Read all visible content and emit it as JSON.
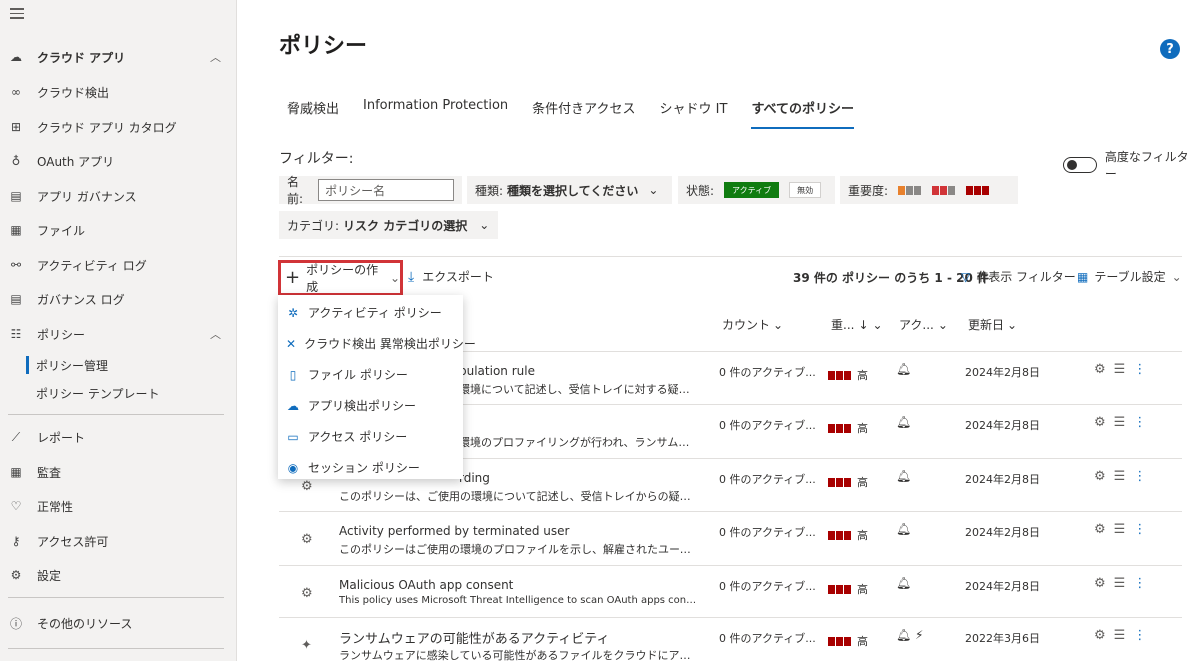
{
  "sidebar": {
    "cloud_apps": "クラウド アプリ",
    "items": [
      {
        "label": "クラウド検出",
        "icon": "binoculars-icon"
      },
      {
        "label": "クラウド アプリ カタログ",
        "icon": "catalog-icon"
      },
      {
        "label": "OAuth アプリ",
        "icon": "oauth-icon"
      },
      {
        "label": "アプリ ガバナンス",
        "icon": "clipboard-icon"
      },
      {
        "label": "ファイル",
        "icon": "file-icon"
      },
      {
        "label": "アクティビティ ログ",
        "icon": "glasses-icon"
      },
      {
        "label": "ガバナンス ログ",
        "icon": "clipboard-icon"
      }
    ],
    "policies": "ポリシー",
    "sub_items": [
      "ポリシー管理",
      "ポリシー テンプレート"
    ],
    "lower_items": [
      {
        "label": "レポート",
        "icon": "chart-icon"
      },
      {
        "label": "監査",
        "icon": "audit-icon"
      },
      {
        "label": "正常性",
        "icon": "heart-icon"
      },
      {
        "label": "アクセス許可",
        "icon": "key-icon"
      },
      {
        "label": "設定",
        "icon": "gear-icon"
      }
    ],
    "more_resources": "その他のリソース"
  },
  "page": {
    "title": "ポリシー",
    "help": "?"
  },
  "tabs": [
    "脅威検出",
    "Information Protection",
    "条件付きアクセス",
    "シャドウ IT",
    "すべてのポリシー"
  ],
  "filters": {
    "title": "フィルター:",
    "advanced": "高度なフィルター",
    "name_label": "名前:",
    "name_placeholder": "ポリシー名",
    "type_label": "種類:",
    "type_value": "種類を選択してください",
    "state_label": "状態:",
    "state_active": "アクティブ",
    "state_disabled": "無効",
    "severity_label": "重要度:",
    "category_label": "カテゴリ:",
    "category_value": "リスク カテゴリの選択"
  },
  "toolbar": {
    "create": "ポリシーの作成",
    "export": "エクスポート",
    "count": "39 件の ポリシー のうち 1 - 20 件",
    "hide_filter": "非表示 フィルター",
    "table_settings": "テーブル設定"
  },
  "columns": {
    "count": "カウント",
    "severity": "重...",
    "action": "アク...",
    "updated": "更新日"
  },
  "menu": [
    {
      "label": "アクティビティ ポリシー",
      "icon": "activity-policy-icon"
    },
    {
      "label": "クラウド検出 異常検出ポリシー",
      "icon": "anomaly-policy-icon"
    },
    {
      "label": "ファイル ポリシー",
      "icon": "file-policy-icon"
    },
    {
      "label": "アプリ検出ポリシー",
      "icon": "app-discovery-icon"
    },
    {
      "label": "アクセス ポリシー",
      "icon": "access-policy-icon"
    },
    {
      "label": "セッション ポリシー",
      "icon": "session-policy-icon"
    }
  ],
  "rows": [
    {
      "name": "pulation rule",
      "desc": "環境について記述し、受信トレイに対する疑わし...",
      "count": "0 件のアクティブ...",
      "sev": "高",
      "date": "2024年2月8日"
    },
    {
      "name": "",
      "desc": "環境のプロファイリングが行われ、ランサムウェ...",
      "count": "0 件のアクティブ...",
      "sev": "高",
      "date": "2024年2月8日"
    },
    {
      "name": "rding",
      "desc": "このポリシーは、ご使用の環境について記述し、受信トレイからの疑わしい...",
      "count": "0 件のアクティブ...",
      "sev": "高",
      "date": "2024年2月8日"
    },
    {
      "name": "Activity performed by terminated user",
      "desc": "このポリシーはご使用の環境のプロファイルを示し、解雇されたユーザーが...",
      "count": "0 件のアクティブ...",
      "sev": "高",
      "date": "2024年2月8日"
    },
    {
      "name": "Malicious OAuth app consent",
      "desc": "This policy uses Microsoft Threat Intelligence to scan OAuth apps connected t...",
      "count": "0 件のアクティブ...",
      "sev": "高",
      "date": "2024年2月8日"
    },
    {
      "name": "ランサムウェアの可能性があるアクティビティ",
      "desc": "ランサムウェアに感染している可能性があるファイルをクラウドにアップロ...",
      "count": "0 件のアクティブ...",
      "sev": "高",
      "date": "2022年3月6日"
    }
  ]
}
